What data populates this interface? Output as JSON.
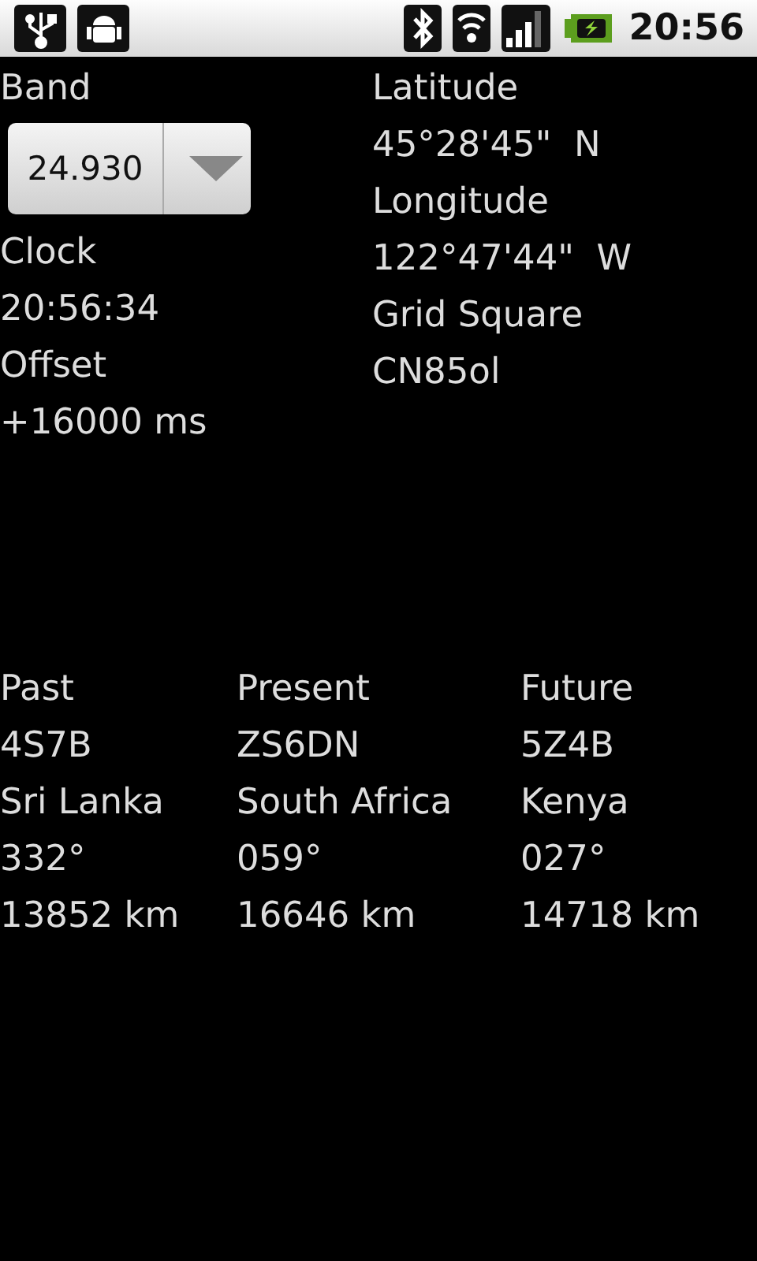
{
  "status_bar": {
    "time": "20:56"
  },
  "band": {
    "label": "Band",
    "value": "24.930"
  },
  "left_fields": [
    {
      "label": "Clock",
      "value": "20:56:34"
    },
    {
      "label": "Offset",
      "value": "+16000 ms"
    }
  ],
  "right_fields": [
    {
      "label": "Latitude",
      "value": "45°28'45\"  N"
    },
    {
      "label": "Longitude",
      "value": "122°47'44\"  W"
    },
    {
      "label": "Grid Square",
      "value": "CN85ol"
    }
  ],
  "beacons": [
    {
      "heading": "Past",
      "callsign": "4S7B",
      "country": "Sri Lanka",
      "bearing": "332°",
      "distance": "13852 km"
    },
    {
      "heading": "Present",
      "callsign": "ZS6DN",
      "country": "South Africa",
      "bearing": "059°",
      "distance": "16646 km"
    },
    {
      "heading": "Future",
      "callsign": "5Z4B",
      "country": "Kenya",
      "bearing": "027°",
      "distance": "14718 km"
    }
  ]
}
